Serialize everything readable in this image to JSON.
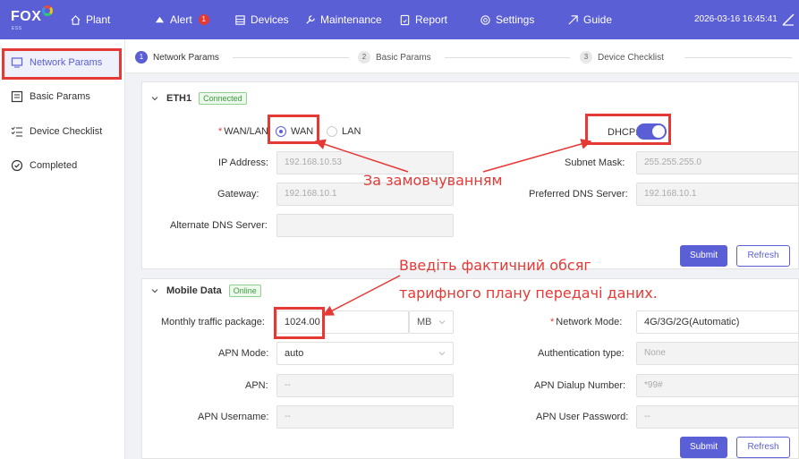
{
  "app": {
    "logo": "FOX",
    "logo_sub": "ESS"
  },
  "nav": {
    "plant": "Plant",
    "alert": "Alert",
    "alert_count": "1",
    "devices": "Devices",
    "maintenance": "Maintenance",
    "report": "Report",
    "settings": "Settings",
    "guide": "Guide",
    "datetime": "2026-03-16 16:45:41"
  },
  "sidebar": {
    "items": [
      {
        "label": "Network Params",
        "icon": "network-icon",
        "active": true
      },
      {
        "label": "Basic Params",
        "icon": "list-icon"
      },
      {
        "label": "Device Checklist",
        "icon": "checklist-icon"
      },
      {
        "label": "Completed",
        "icon": "check-circle-icon"
      }
    ]
  },
  "stepper": {
    "steps": [
      {
        "num": "1",
        "label": "Network Params"
      },
      {
        "num": "2",
        "label": "Basic Params"
      },
      {
        "num": "3",
        "label": "Device Checklist"
      }
    ]
  },
  "eth1": {
    "title": "ETH1",
    "status": "Connected",
    "wan_lan_label": "WAN/LAN:",
    "wan": "WAN",
    "lan": "LAN",
    "mode_selected": "WAN",
    "dhcp_label": "DHCP:",
    "dhcp_on": true,
    "ip_label": "IP Address:",
    "ip_value": "192.168.10.53",
    "subnet_label": "Subnet Mask:",
    "subnet_value": "255.255.255.0",
    "gateway_label": "Gateway:",
    "gateway_value": "192.168.10.1",
    "dns_label": "Preferred DNS Server:",
    "dns_value": "192.168.10.1",
    "alt_dns_label": "Alternate DNS Server:",
    "alt_dns_value": "",
    "submit": "Submit",
    "refresh": "Refresh"
  },
  "mobile": {
    "title": "Mobile Data",
    "status": "Online",
    "traffic_label": "Monthly traffic package:",
    "traffic_value": "1024.00",
    "traffic_unit": "MB",
    "network_mode_label": "Network Mode:",
    "network_mode_value": "4G/3G/2G(Automatic)",
    "apn_mode_label": "APN Mode:",
    "apn_mode_value": "auto",
    "auth_label": "Authentication type:",
    "auth_value": "None",
    "apn_label": "APN:",
    "apn_value": "--",
    "dialup_label": "APN Dialup Number:",
    "dialup_value": "*99#",
    "username_label": "APN Username:",
    "username_value": "--",
    "password_label": "APN User Password:",
    "password_value": "--",
    "submit": "Submit",
    "refresh": "Refresh"
  },
  "annotations": {
    "default": "За замовчуванням",
    "traffic_line1": "Введіть фактичний обсяг",
    "traffic_line2": "тарифного плану передачі даних."
  },
  "colors": {
    "brand": "#5b5fd6",
    "annotation": "#e53935",
    "status_green": "#3c9a3c"
  }
}
